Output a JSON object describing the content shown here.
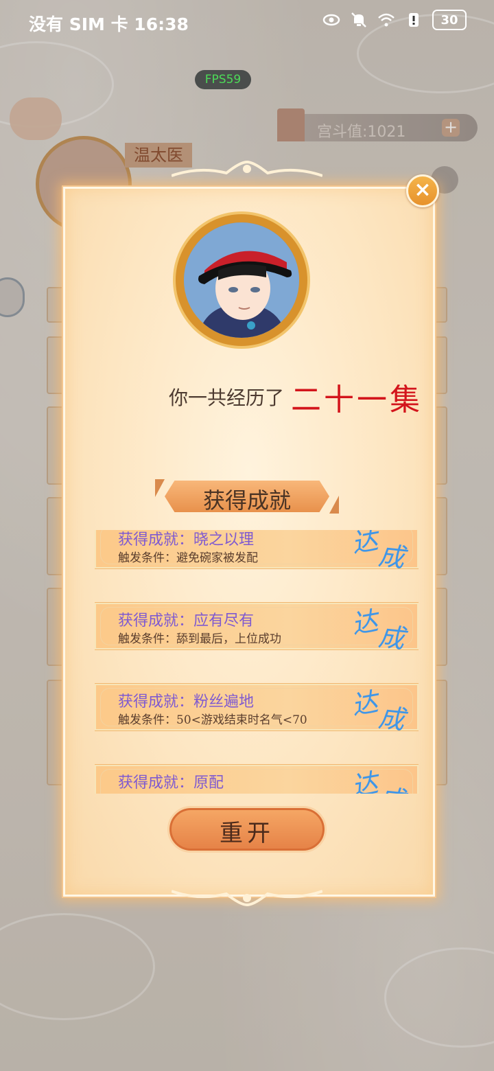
{
  "status_bar": {
    "carrier_time": "没有 SIM 卡 16:38",
    "battery": "30",
    "icons": [
      "eye-icon",
      "mute-bell-icon",
      "wifi-icon",
      "alert-icon",
      "battery-icon"
    ]
  },
  "fps_badge": "FPS59",
  "game_hud": {
    "palace_points": "宫斗值:1021",
    "plus_label": "+",
    "character_name": "温太医"
  },
  "modal": {
    "close_label": "×",
    "episode_prefix": "你一共经历了",
    "episode_count": "二十一集",
    "achievements_title": "获得成就",
    "achievements": [
      {
        "name": "获得成就：晓之以理",
        "condition": "触发条件：避免碗家被发配",
        "stamp": "达成"
      },
      {
        "name": "获得成就：应有尽有",
        "condition": "触发条件：舔到最后，上位成功",
        "stamp": "达成"
      },
      {
        "name": "获得成就：粉丝遍地",
        "condition": "触发条件：50<游戏结束时名气<70",
        "stamp": "达成"
      },
      {
        "name": "获得成就：原配",
        "condition": "",
        "stamp": "达成"
      }
    ],
    "restart_label": "重开"
  },
  "colors": {
    "episode_red": "#d3151c",
    "achievement_name": "#7f5ad0",
    "stamp_blue": "#3f96e8",
    "fps_green": "#4ddb58"
  }
}
